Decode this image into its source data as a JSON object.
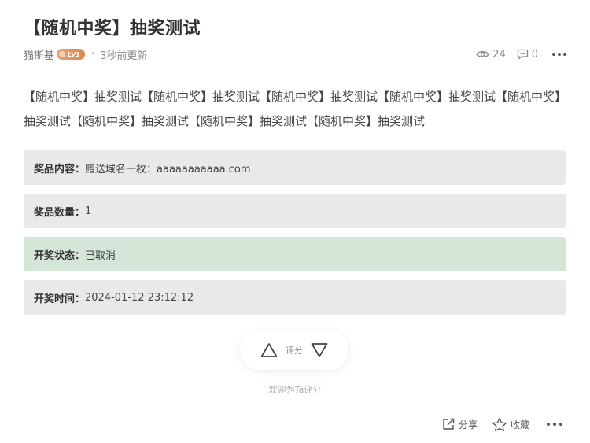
{
  "post": {
    "title": "【随机中奖】抽奖测试",
    "author": "猫斯基",
    "level": "LV1",
    "updated": "3秒前更新",
    "views": "24",
    "comments": "0",
    "content": "【随机中奖】抽奖测试【随机中奖】抽奖测试【随机中奖】抽奖测试【随机中奖】抽奖测试【随机中奖】抽奖测试【随机中奖】抽奖测试【随机中奖】抽奖测试【随机中奖】抽奖测试"
  },
  "lottery": {
    "prize_label": "奖品内容：",
    "prize_value": "赠送域名一枚：aaaaaaaaaaa.com",
    "quantity_label": "奖品数量：",
    "quantity_value": "1",
    "status_label": "开奖状态：",
    "status_value": "已取消",
    "time_label": "开奖时间：",
    "time_value": "2024-01-12 23:12:12"
  },
  "rating": {
    "label": "评分",
    "hint": "欢迎为Ta评分"
  },
  "actions": {
    "share": "分享",
    "favorite": "收藏"
  },
  "icons": {
    "views": "eye-icon",
    "comments": "comment-icon",
    "more": "more-dots-icon",
    "upvote": "triangle-up-icon",
    "downvote": "triangle-down-icon",
    "share": "share-icon",
    "favorite": "star-icon"
  },
  "colors": {
    "status_box": "#d4e6d8",
    "info_box": "#e8e9ea",
    "level_badge": "#d98a52"
  }
}
